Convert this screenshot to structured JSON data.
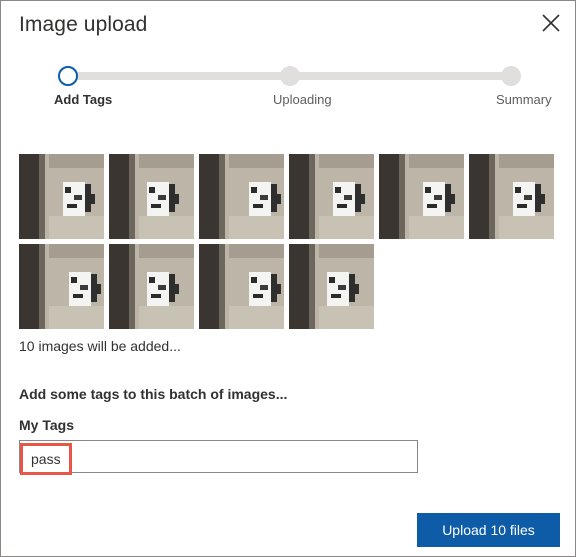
{
  "dialog": {
    "title": "Image upload",
    "close_icon": "close-icon"
  },
  "stepper": {
    "steps": [
      {
        "label": "Add Tags",
        "state": "active"
      },
      {
        "label": "Uploading",
        "state": "pending"
      },
      {
        "label": "Summary",
        "state": "pending"
      }
    ],
    "colors": {
      "active": "#0e5ca8",
      "pending": "#e1dfdd"
    }
  },
  "images": {
    "thumbnails": [
      {
        "variant": "a"
      },
      {
        "variant": "b"
      },
      {
        "variant": "c"
      },
      {
        "variant": "a"
      },
      {
        "variant": "a"
      },
      {
        "variant": "a"
      },
      {
        "variant": "c"
      },
      {
        "variant": "b"
      },
      {
        "variant": "c"
      },
      {
        "variant": "b"
      }
    ],
    "count_text": "10 images will be added..."
  },
  "tags": {
    "heading": "Add some tags to this batch of images...",
    "label": "My Tags",
    "chips": [
      "pass"
    ],
    "input_value": "",
    "highlight_color": "#e8564a"
  },
  "actions": {
    "upload_label": "Upload 10 files",
    "primary_color": "#0e5ca8"
  }
}
